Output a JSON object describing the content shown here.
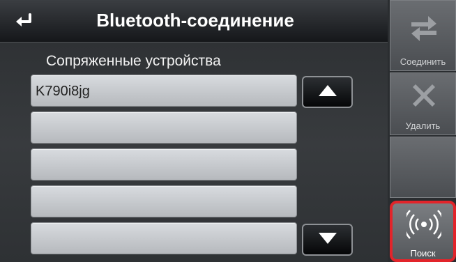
{
  "header": {
    "title": "Bluetooth-соединение",
    "back_icon": "return-arrow-icon"
  },
  "paired_devices": {
    "label": "Сопряженные устройства",
    "items": [
      "K790i8jg",
      "",
      "",
      "",
      ""
    ]
  },
  "scroll": {
    "up_icon": "triangle-up-icon",
    "down_icon": "triangle-down-icon"
  },
  "sidebar": {
    "connect_label": "Соединить",
    "connect_icon": "swap-arrows-icon",
    "delete_label": "Удалить",
    "delete_icon": "x-cross-icon",
    "search_label": "Поиск",
    "search_icon": "signal-waves-icon"
  },
  "colors": {
    "highlight": "#e2242a",
    "list_item": "#c8cbcf",
    "sidebar": "#5a5d61"
  }
}
